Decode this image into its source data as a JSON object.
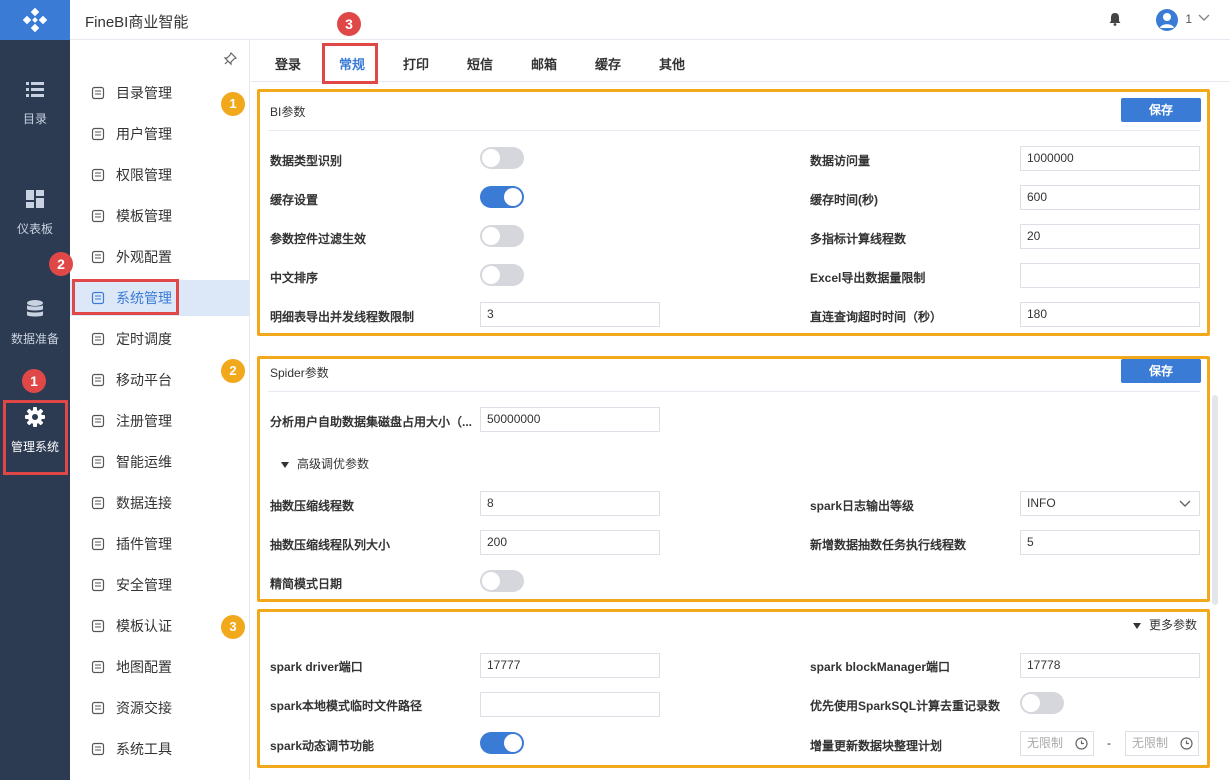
{
  "header": {
    "brand": "FineBI商业智能",
    "user": "1"
  },
  "rail": {
    "items": [
      {
        "label": "目录"
      },
      {
        "label": "仪表板"
      },
      {
        "label": "数据准备"
      },
      {
        "label": "管理系统"
      }
    ]
  },
  "menu": {
    "items": [
      {
        "label": "目录管理"
      },
      {
        "label": "用户管理"
      },
      {
        "label": "权限管理"
      },
      {
        "label": "模板管理"
      },
      {
        "label": "外观配置"
      },
      {
        "label": "系统管理"
      },
      {
        "label": "定时调度"
      },
      {
        "label": "移动平台"
      },
      {
        "label": "注册管理"
      },
      {
        "label": "智能运维"
      },
      {
        "label": "数据连接"
      },
      {
        "label": "插件管理"
      },
      {
        "label": "安全管理"
      },
      {
        "label": "模板认证"
      },
      {
        "label": "地图配置"
      },
      {
        "label": "资源交接"
      },
      {
        "label": "系统工具"
      }
    ]
  },
  "tabs": [
    "登录",
    "常规",
    "打印",
    "短信",
    "邮箱",
    "缓存",
    "其他"
  ],
  "bi": {
    "title": "BI参数",
    "save": "保存",
    "left": [
      {
        "label": "数据类型识别"
      },
      {
        "label": "缓存设置"
      },
      {
        "label": "参数控件过滤生效"
      },
      {
        "label": "中文排序"
      },
      {
        "label": "明细表导出并发线程数限制",
        "value": "3"
      }
    ],
    "right": [
      {
        "label": "数据访问量",
        "value": "1000000"
      },
      {
        "label": "缓存时间(秒)",
        "value": "600"
      },
      {
        "label": "多指标计算线程数",
        "value": "20"
      },
      {
        "label": "Excel导出数据量限制",
        "value": ""
      },
      {
        "label": "直连查询超时时间（秒）",
        "value": "180"
      }
    ]
  },
  "spider": {
    "title": "Spider参数",
    "save": "保存",
    "disk_label": "分析用户自助数据集磁盘占用大小（...",
    "disk_value": "50000000",
    "advanced": "高级调优参数",
    "compress_threads_label": "抽数压缩线程数",
    "compress_threads_value": "8",
    "log_level_label": "spark日志输出等级",
    "log_level_value": "INFO",
    "queue_label": "抽数压缩线程队列大小",
    "queue_value": "200",
    "new_task_label": "新增数据抽数任务执行线程数",
    "new_task_value": "5",
    "simple_label": "精简模式日期"
  },
  "more": {
    "toggle": "更多参数",
    "driver_label": "spark driver端口",
    "driver_value": "17777",
    "block_label": "spark blockManager端口",
    "block_value": "17778",
    "local_path_label": "spark本地模式临时文件路径",
    "local_path_value": "",
    "sparksql_label": "优先使用SparkSQL计算去重记录数",
    "dynamic_label": "spark动态调节功能",
    "plan_label": "增量更新数据块整理计划",
    "plan_from": "无限制",
    "plan_sep": "-",
    "plan_to": "无限制"
  },
  "badges": {
    "o1": "1",
    "o2": "2",
    "o3": "3",
    "r1": "1",
    "r2": "2",
    "r3": "3"
  },
  "colors": {
    "accent": "#3a7bd5",
    "rail": "#2c3a52",
    "annotation_orange": "#f2a81b",
    "annotation_red": "#e04848"
  }
}
